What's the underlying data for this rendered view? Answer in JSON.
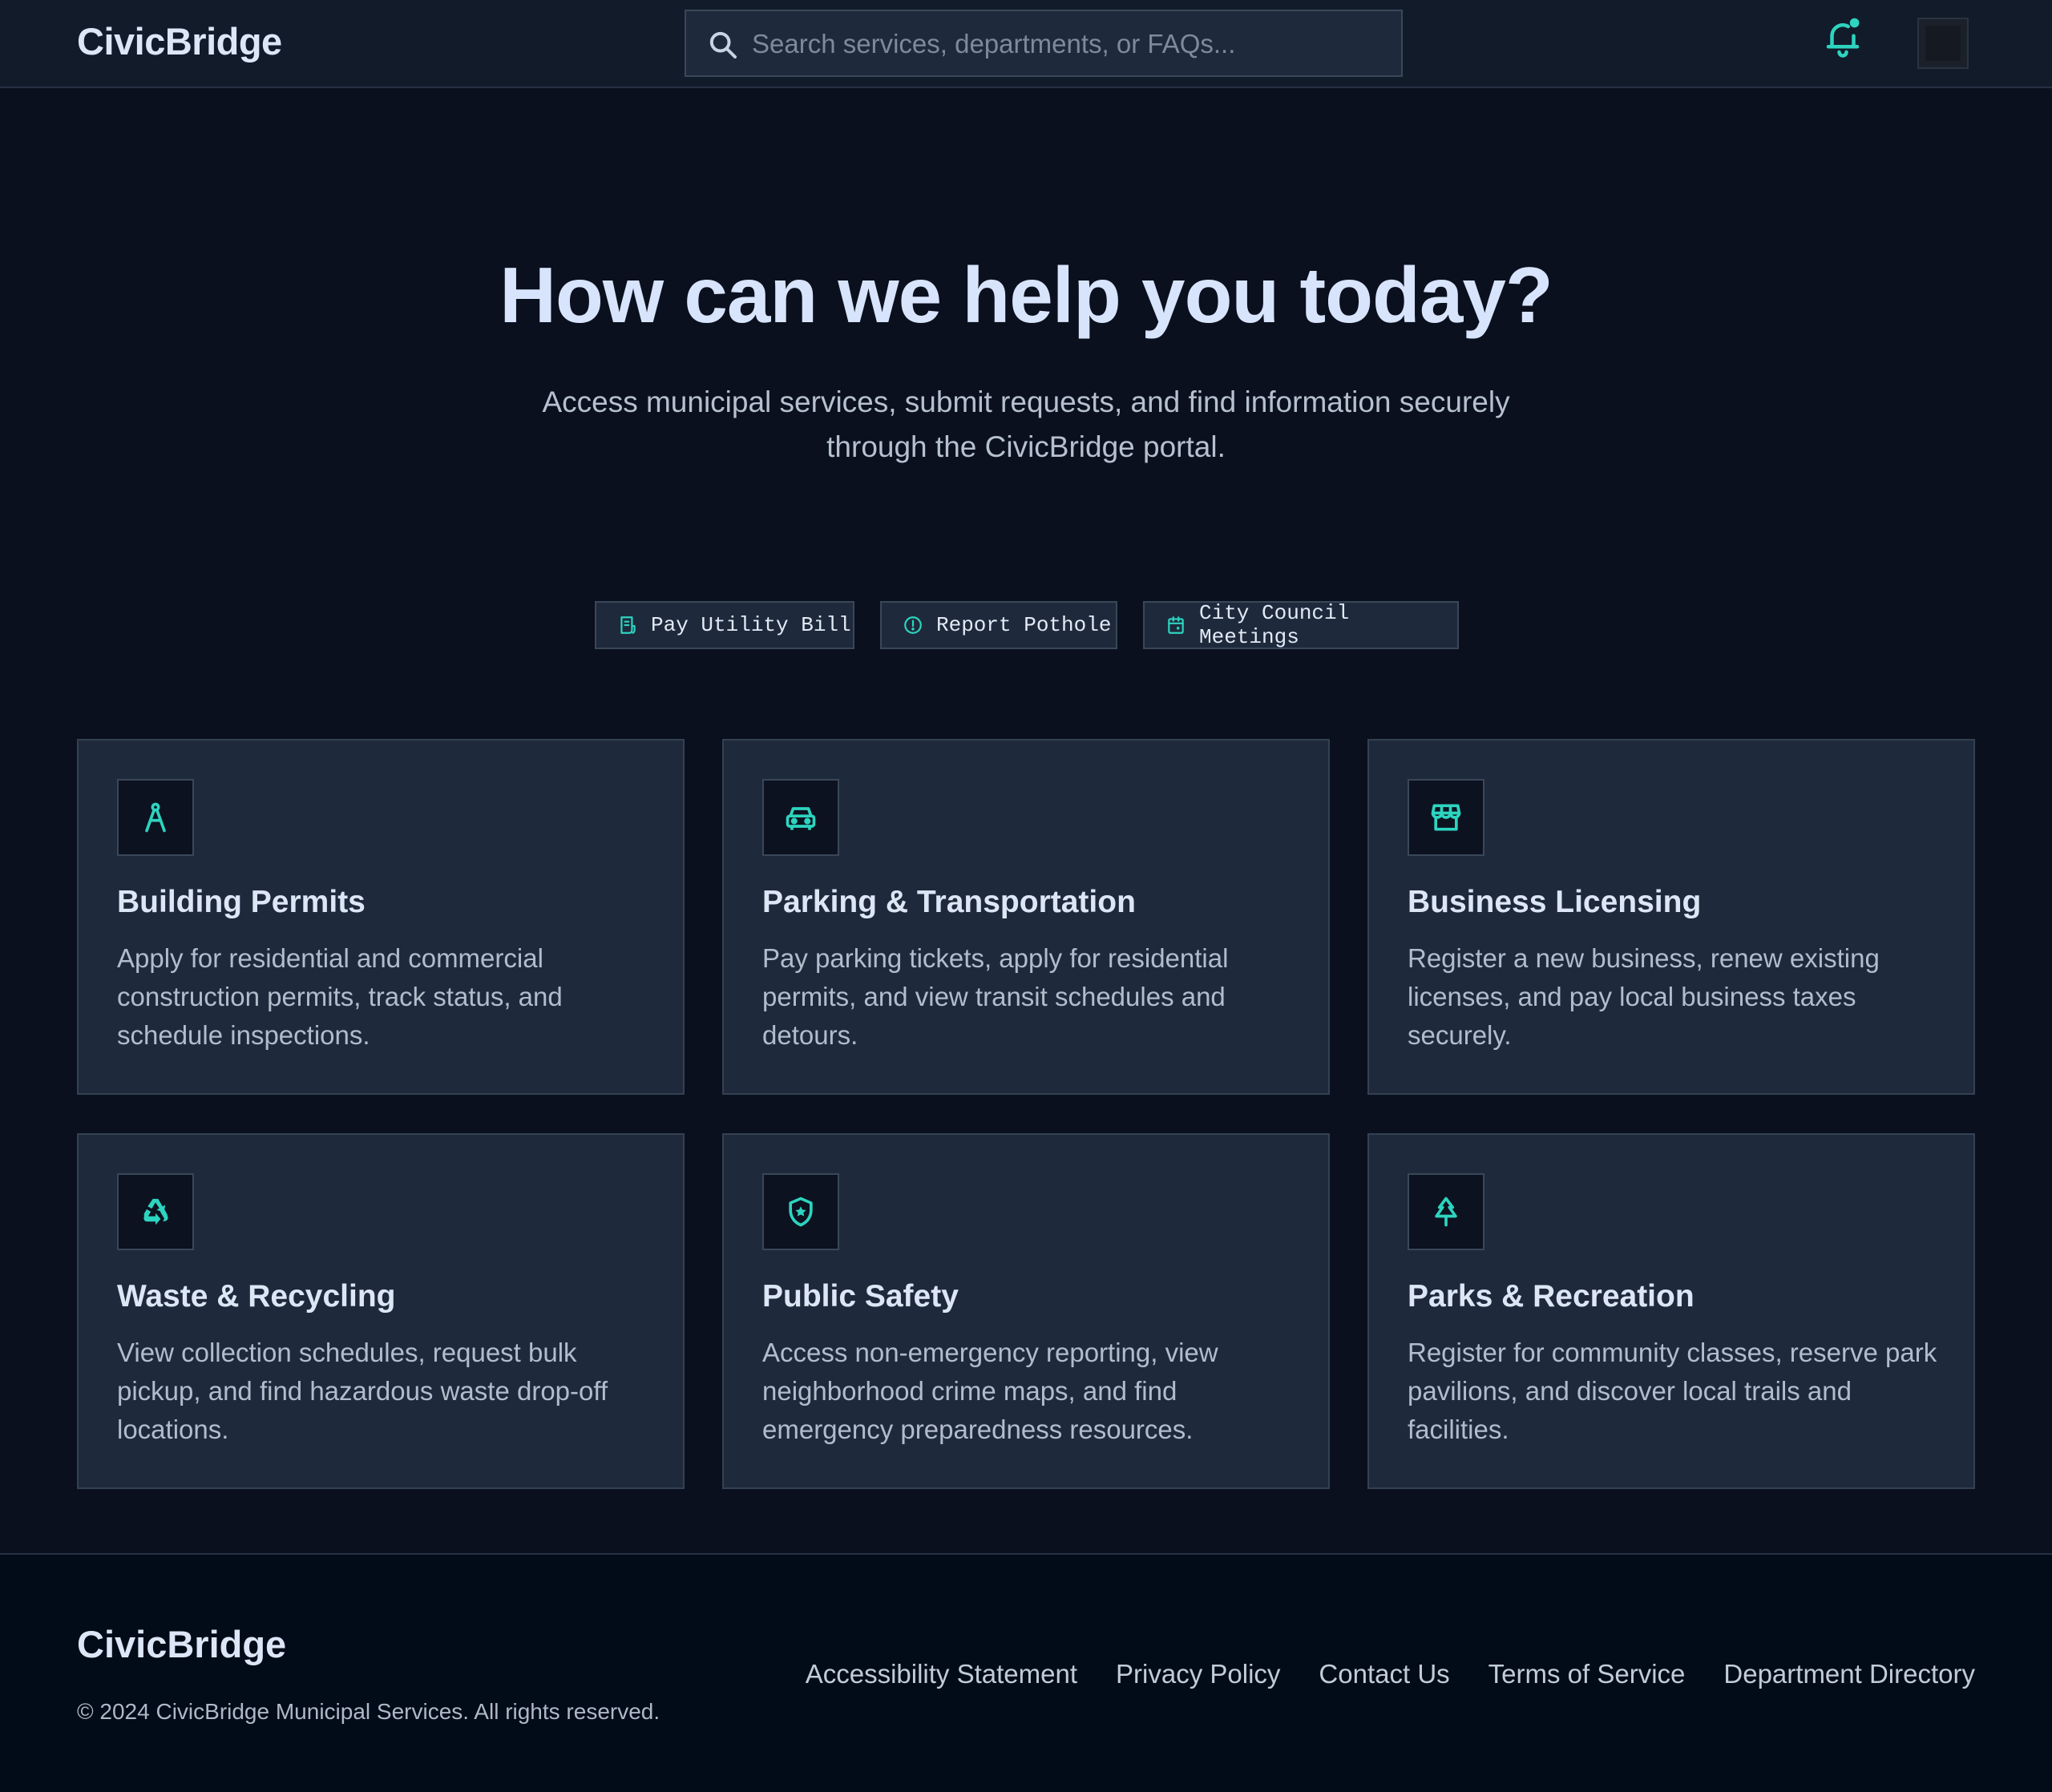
{
  "header": {
    "brand": "CivicBridge",
    "search_placeholder": "Search services, departments, or FAQs...",
    "icons": {
      "search": "search-icon",
      "notifications": "bell-icon",
      "profile": "avatar"
    }
  },
  "hero": {
    "title": "How can we help you today?",
    "subtitle_line1": "Access municipal services, submit requests, and find information securely",
    "subtitle_line2": "through the CivicBridge portal."
  },
  "quick_actions": [
    {
      "label": "Pay Utility Bill",
      "icon": "receipt-icon"
    },
    {
      "label": "Report Pothole",
      "icon": "alert-circle-icon"
    },
    {
      "label": "City Council Meetings",
      "icon": "calendar-icon"
    }
  ],
  "services": [
    {
      "title": "Building Permits",
      "description": "Apply for residential and commercial construction permits, track status, and schedule inspections.",
      "icon": "compass-icon"
    },
    {
      "title": "Parking & Transportation",
      "description": "Pay parking tickets, apply for residential permits, and view transit schedules and detours.",
      "icon": "car-icon"
    },
    {
      "title": "Business Licensing",
      "description": "Register a new business, renew existing licenses, and pay local business taxes securely.",
      "icon": "storefront-icon"
    },
    {
      "title": "Waste & Recycling",
      "description": "View collection schedules, request bulk pickup, and find hazardous waste drop-off locations.",
      "icon": "recycle-icon"
    },
    {
      "title": "Public Safety",
      "description": "Access non-emergency reporting, view neighborhood crime maps, and find emergency preparedness resources.",
      "icon": "shield-star-icon"
    },
    {
      "title": "Parks & Recreation",
      "description": "Register for community classes, reserve park pavilions, and discover local trails and facilities.",
      "icon": "tree-icon"
    }
  ],
  "footer": {
    "brand": "CivicBridge",
    "copyright": "© 2024 CivicBridge Municipal Services. All rights reserved.",
    "links": [
      "Accessibility Statement",
      "Privacy Policy",
      "Contact Us",
      "Terms of Service",
      "Department Directory"
    ]
  },
  "colors": {
    "accent": "#2dd4bf",
    "background": "#0a101e",
    "header_bg": "#111b2a",
    "card_bg": "#1e2a3c",
    "footer_bg": "#020b18",
    "heading": "#d8e4fb"
  }
}
